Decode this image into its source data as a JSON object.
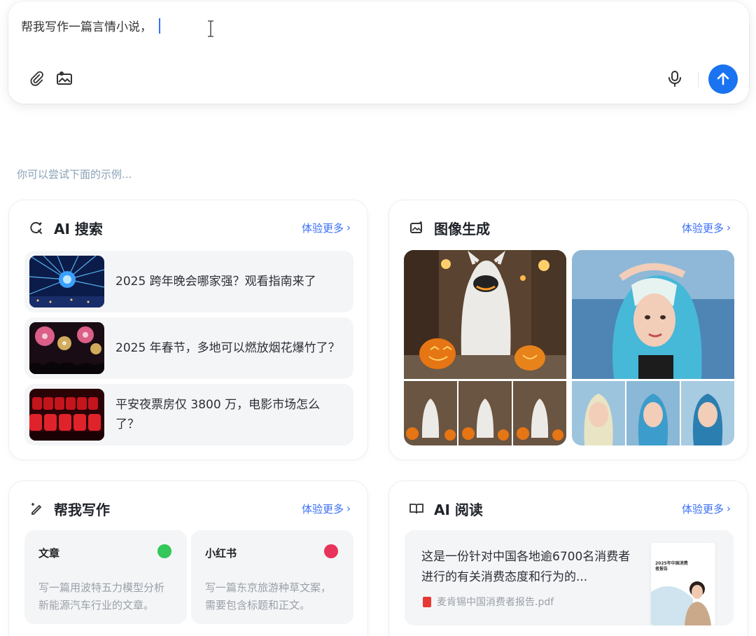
{
  "input": {
    "value": "帮我写作一篇言情小说，",
    "tools": [
      "attachment-icon",
      "image-upload-icon",
      "microphone-icon",
      "send-arrow-icon"
    ]
  },
  "hint": "你可以尝试下面的示例...",
  "cards": {
    "search": {
      "title": "AI 搜索",
      "more": "体验更多",
      "items": [
        {
          "text": "2025 跨年晚会哪家强？观看指南来了"
        },
        {
          "text": "2025 年春节，多地可以燃放烟花爆竹了？"
        },
        {
          "text": "平安夜票房仅 3800 万，电影市场怎么了？"
        }
      ]
    },
    "image": {
      "title": "图像生成",
      "more": "体验更多"
    },
    "write": {
      "title": "帮我写作",
      "more": "体验更多",
      "items": [
        {
          "title": "文章",
          "desc": "写一篇用波特五力模型分析新能源汽车行业的文章。",
          "badge_color": "#34c759"
        },
        {
          "title": "小红书",
          "desc": "写一篇东京旅游种草文案，需要包含标题和正文。",
          "badge_color": "#e8335a"
        }
      ]
    },
    "read": {
      "title": "AI 阅读",
      "more": "体验更多",
      "summary": "这是一份针对中国各地逾6700名消费者进行的有关消费态度和行为的...",
      "file": "麦肯锡中国消费者报告.pdf",
      "thumb_title": "2025年中国消费者报告"
    }
  },
  "colors": {
    "accent": "#1a73f0",
    "link": "#3a6ff7",
    "card_bg": "#f4f5f7"
  }
}
